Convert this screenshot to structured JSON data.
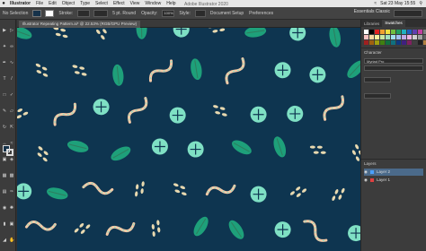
{
  "menubar": {
    "app_name": "Illustrator",
    "items": [
      "File",
      "Edit",
      "Object",
      "Type",
      "Select",
      "Effect",
      "View",
      "Window",
      "Help"
    ],
    "clock": "Sat 23 May 15:55"
  },
  "control_bar": {
    "selection_label": "No Selection",
    "stroke_label": "Stroke:",
    "brush_label": "5 pt. Round",
    "opacity_label": "Opacity:",
    "opacity_value": "100%",
    "style_label": "Style:",
    "document_setup": "Document Setup",
    "preferences": "Preferences",
    "window_title": "Adobe Illustrator 2020",
    "workspace": "Essentials Classic"
  },
  "document": {
    "tab_label": "Illustrator Repeating Pattern.ai* @ 22.53% (RGB/GPU Preview)"
  },
  "panels": {
    "tabs": [
      "Libraries",
      "Swatches"
    ],
    "swatch_colors": [
      "#ffffff",
      "#000000",
      "#e02020",
      "#f0a030",
      "#f0e040",
      "#70c040",
      "#20a060",
      "#20b0c0",
      "#2060c0",
      "#6040b0",
      "#c040a0",
      "#808080",
      "#f4c0c0",
      "#f8d8a0",
      "#f8f0a0",
      "#c8e8a0",
      "#a0e0c0",
      "#a0e0f0",
      "#a0c0f0",
      "#c0a8e8",
      "#f0b0e0",
      "#d0d0d0",
      "#a0a0a0",
      "#606060",
      "#a02020",
      "#a06010",
      "#a0a010",
      "#408010",
      "#107040",
      "#107080",
      "#103880",
      "#402080",
      "#802060",
      "#404040",
      "#202020",
      "#b08040"
    ],
    "character_label": "Character",
    "font_name": "Myriad Pro",
    "layers_label": "Layers",
    "layer_items": [
      "Layer 2",
      "Layer 1"
    ]
  },
  "pattern": {
    "bg": "#0e3550",
    "colors": [
      "#1ea07a",
      "#7fe0c4",
      "#f4c9a6",
      "#e8d9b0",
      "#2e7d5f"
    ]
  }
}
